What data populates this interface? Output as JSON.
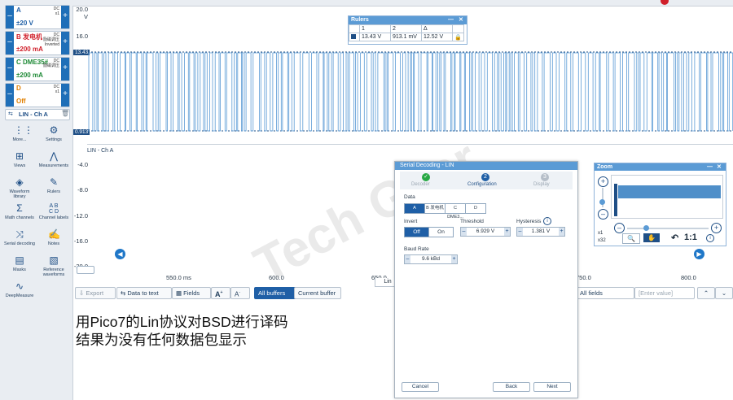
{
  "channels": [
    {
      "id": "A",
      "label": "A",
      "coupling": "DC",
      "probe": "x1",
      "range": "±20 V",
      "color": "#1f5fa6"
    },
    {
      "id": "B",
      "label": "B 发电机",
      "coupling": "DC",
      "probe": "励磁调压",
      "extra": "Inverted",
      "range": "±200 mA",
      "color": "#d01f2a"
    },
    {
      "id": "C",
      "label": "C DME35#",
      "coupling": "DC",
      "probe": "励磁调压",
      "range": "±200 mA",
      "color": "#1e8a36"
    },
    {
      "id": "D",
      "label": "D",
      "coupling": "DC",
      "probe": "x1",
      "range": "Off",
      "color": "#e07f00"
    }
  ],
  "decode_chip": {
    "label": "LIN - Ch A"
  },
  "tools": [
    {
      "label": "More...",
      "icon": "more-icon"
    },
    {
      "label": "Settings",
      "icon": "gear-icon"
    },
    {
      "label": "Views",
      "icon": "views-icon"
    },
    {
      "label": "Measurements",
      "icon": "measurements-icon"
    },
    {
      "label": "Waveform library",
      "icon": "waveform-library-icon"
    },
    {
      "label": "Rulers",
      "icon": "ruler-icon"
    },
    {
      "label": "Math channels",
      "icon": "math-icon"
    },
    {
      "label": "Channel labels",
      "icon": "channel-labels-icon"
    },
    {
      "label": "Serial decoding",
      "icon": "serial-decoding-icon"
    },
    {
      "label": "Notes",
      "icon": "notes-icon"
    },
    {
      "label": "Masks",
      "icon": "masks-icon"
    },
    {
      "label": "Reference waveforms",
      "icon": "reference-waveforms-icon"
    },
    {
      "label": "DeepMeasure",
      "icon": "deepmeasure-icon"
    }
  ],
  "plot": {
    "y_unit": "V",
    "y_ticks": [
      "20.0",
      "16.0",
      "12.0",
      "-4.0",
      "-8.0",
      "-12.0",
      "-16.0",
      "-20.0"
    ],
    "x_ticks": [
      "550.0 ms",
      "600.0",
      "650.0",
      "750.0",
      "800.0"
    ],
    "high_marker": "13.43",
    "low_marker": "0.913",
    "decode_label": "LIN - Ch A",
    "decode_tab": "Lin",
    "trace_color": "#5b9bd5"
  },
  "rulers": {
    "title": "Rulers",
    "headers": [
      "1",
      "2",
      "Δ"
    ],
    "values": [
      "13.43 V",
      "913.1 mV",
      "12.52 V"
    ]
  },
  "toolbar": {
    "export": "Export",
    "data_to_text": "Data to text",
    "fields": "Fields",
    "all_buffers": "All buffers",
    "current_buffer": "Current buffer",
    "all_fields": "All fields",
    "enter_value": "[Enter value]"
  },
  "caption": {
    "line1": "用Pico7的Lin协议对BSD进行译码",
    "line2": "结果为没有任何数据包显示"
  },
  "dialog": {
    "title": "Serial Decoding - LIN",
    "steps": [
      "Decoder",
      "Configuration",
      "Display"
    ],
    "step_numbers": [
      "✓",
      "2",
      "3"
    ],
    "data_label": "Data",
    "data_options": [
      "A",
      "B 发电机",
      "C DME3...",
      "D"
    ],
    "invert_label": "Invert",
    "invert_options": [
      "Off",
      "On"
    ],
    "threshold_label": "Threshold",
    "threshold_value": "6.929 V",
    "hysteresis_label": "Hysteresis",
    "hysteresis_value": "1.381 V",
    "baud_label": "Baud Rate",
    "baud_value": "9.6 kBd",
    "cancel": "Cancel",
    "back": "Back",
    "next": "Next"
  },
  "zoom": {
    "title": "Zoom",
    "x1": "x1",
    "x32": "x32",
    "ratio": "1:1"
  },
  "watermark": "Tech Gear"
}
